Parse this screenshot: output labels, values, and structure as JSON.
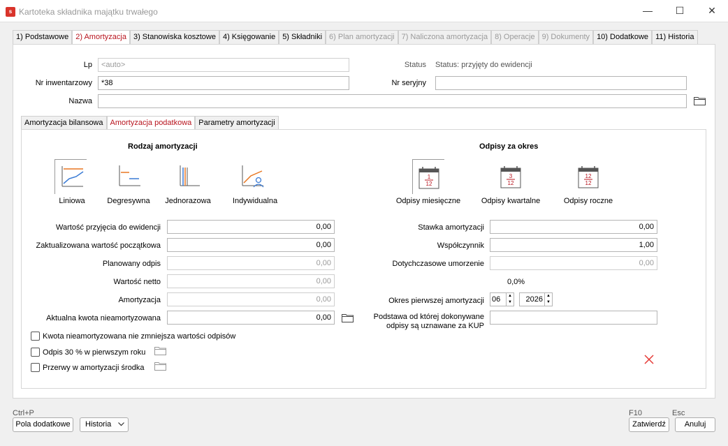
{
  "window": {
    "title": "Kartoteka składnika majątku trwałego",
    "app_icon_letter": "s",
    "minimize": "—",
    "maximize": "☐",
    "close": "✕"
  },
  "tabs": [
    {
      "label": "1) Podstawowe",
      "state": "normal"
    },
    {
      "label": "2) Amortyzacja",
      "state": "active"
    },
    {
      "label": "3) Stanowiska kosztowe",
      "state": "normal"
    },
    {
      "label": "4) Księgowanie",
      "state": "normal"
    },
    {
      "label": "5) Składniki",
      "state": "normal"
    },
    {
      "label": "6) Plan amortyzacji",
      "state": "disabled"
    },
    {
      "label": "7) Naliczona amortyzacja",
      "state": "disabled"
    },
    {
      "label": "8) Operacje",
      "state": "disabled"
    },
    {
      "label": "9) Dokumenty",
      "state": "disabled"
    },
    {
      "label": "10) Dodatkowe",
      "state": "normal"
    },
    {
      "label": "11) Historia",
      "state": "normal"
    }
  ],
  "header": {
    "lp_label": "Lp",
    "lp_value": "<auto>",
    "status_label": "Status",
    "status_value": "Status: przyjęty do ewidencji",
    "nr_inw_label": "Nr inwentarzowy",
    "nr_inw_value": "*38",
    "nr_ser_label": "Nr seryjny",
    "nr_ser_value": "",
    "nazwa_label": "Nazwa",
    "nazwa_value": ""
  },
  "subtabs": [
    {
      "label": "Amortyzacja bilansowa",
      "state": "normal"
    },
    {
      "label": "Amortyzacja podatkowa",
      "state": "active"
    },
    {
      "label": "Parametry amortyzacji",
      "state": "normal"
    }
  ],
  "rodzaj": {
    "title": "Rodzaj amortyzacji",
    "options": [
      "Liniowa",
      "Degresywna",
      "Jednorazowa",
      "Indywidualna"
    ],
    "selected": "Liniowa"
  },
  "odpisy": {
    "title": "Odpisy za okres",
    "options": [
      "Odpisy miesięczne",
      "Odpisy kwartalne",
      "Odpisy roczne"
    ],
    "icon_top": [
      "1",
      "3",
      "12"
    ],
    "icon_bottom": [
      "12",
      "12",
      "12"
    ],
    "selected": "Odpisy miesięczne"
  },
  "left_fields": [
    {
      "label": "Wartość przyjęcia do ewidencji",
      "value": "0,00",
      "enabled": true
    },
    {
      "label": "Zaktualizowana wartość początkowa",
      "value": "0,00",
      "enabled": true
    },
    {
      "label": "Planowany odpis",
      "value": "0,00",
      "enabled": false
    },
    {
      "label": "Wartość netto",
      "value": "0,00",
      "enabled": false
    },
    {
      "label": "Amortyzacja",
      "value": "0,00",
      "enabled": false
    },
    {
      "label": "Aktualna kwota nieamortyzowana",
      "value": "0,00",
      "enabled": true
    }
  ],
  "right_fields": {
    "stawka_label": "Stawka amortyzacji",
    "stawka_value": "0,00",
    "wspolczynnik_label": "Współczynnik",
    "wspolczynnik_value": "1,00",
    "dotychczasowe_label": "Dotychczasowe umorzenie",
    "dotychczasowe_value": "0,00",
    "percent_value": "0,0%",
    "okres_label": "Okres pierwszej amortyzacji",
    "okres_month": "06",
    "okres_year": "2026",
    "podstawa_label_1": "Podstawa od której dokonywane",
    "podstawa_label_2": "odpisy są uznawane za KUP",
    "podstawa_value": ""
  },
  "checkboxes": [
    {
      "label": "Kwota nieamortyzowana nie zmniejsza wartości odpisów",
      "checked": false
    },
    {
      "label": "Odpis 30 % w pierwszym roku",
      "checked": false
    },
    {
      "label": "Przerwy w amortyzacji środka",
      "checked": false
    }
  ],
  "footer": {
    "shortcut_left": "Ctrl+P",
    "pola_button": "Pola dodatkowe",
    "historia_button": "Historia",
    "shortcut_f10": "F10",
    "shortcut_esc": "Esc",
    "zatwierdz_button": "Zatwierdź",
    "anuluj_button": "Anuluj"
  },
  "colors": {
    "accent": "#b8141e",
    "chart_line": "#e87722",
    "chart_blue": "#3a7bd5",
    "delete_x": "#e53935"
  }
}
